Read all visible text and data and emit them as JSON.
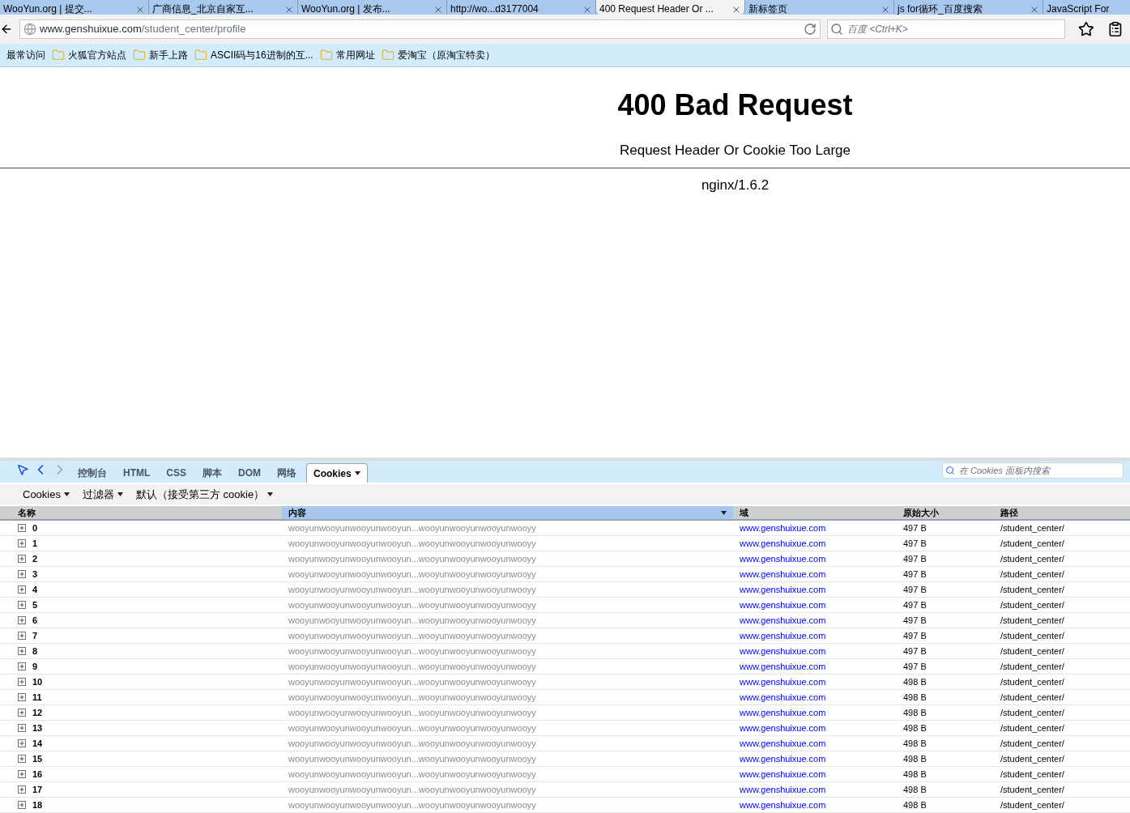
{
  "tabs": [
    {
      "label": "WooYun.org | 提交...",
      "selected": false
    },
    {
      "label": "广商信息_北京自家互...",
      "selected": false
    },
    {
      "label": "WooYun.org | 发布...",
      "selected": false
    },
    {
      "label": "http://wo...d3177004",
      "selected": false
    },
    {
      "label": "400 Request Header Or ...",
      "selected": true
    },
    {
      "label": "新标签页",
      "selected": false
    },
    {
      "label": "js for循环_百度搜索",
      "selected": false
    },
    {
      "label": "JavaScript For",
      "selected": false
    }
  ],
  "address": {
    "host": "www.genshuixue.com",
    "path": "/student_center/profile"
  },
  "search": {
    "placeholder": "百度 <Ctrl+K>"
  },
  "bookmarks": [
    "最常访问",
    "火狐官方站点",
    "新手上路",
    "ASCII码与16进制的互...",
    "常用网址",
    "爱淘宝（原淘宝特卖）"
  ],
  "page": {
    "title": "400 Bad Request",
    "message": "Request Header Or Cookie Too Large",
    "server": "nginx/1.6.2"
  },
  "devtools": {
    "tabs": [
      {
        "label": "控制台",
        "selected": false
      },
      {
        "label": "HTML",
        "selected": false
      },
      {
        "label": "CSS",
        "selected": false
      },
      {
        "label": "脚本",
        "selected": false
      },
      {
        "label": "DOM",
        "selected": false
      },
      {
        "label": "网络",
        "selected": false
      },
      {
        "label": "Cookies",
        "selected": true
      }
    ],
    "search": {
      "placeholder": "在 Cookies 面板内搜索"
    },
    "menus": [
      "Cookies",
      "过滤器",
      "默认（接受第三方 cookie）"
    ],
    "table": {
      "columns": [
        {
          "label": "名称",
          "selected": false
        },
        {
          "label": "内容",
          "selected": true
        },
        {
          "label": "域",
          "selected": false
        },
        {
          "label": "原始大小",
          "selected": false
        },
        {
          "label": "路径",
          "selected": false
        }
      ],
      "rows": [
        [
          "0",
          "wooyunwooyunwooyunwooyun...wooyunwooyunwooyunwooyy",
          "www.genshuixue.com",
          "497 B",
          "/student_center/"
        ],
        [
          "1",
          "wooyunwooyunwooyunwooyun...wooyunwooyunwooyunwooyy",
          "www.genshuixue.com",
          "497 B",
          "/student_center/"
        ],
        [
          "2",
          "wooyunwooyunwooyunwooyun...wooyunwooyunwooyunwooyy",
          "www.genshuixue.com",
          "497 B",
          "/student_center/"
        ],
        [
          "3",
          "wooyunwooyunwooyunwooyun...wooyunwooyunwooyunwooyy",
          "www.genshuixue.com",
          "497 B",
          "/student_center/"
        ],
        [
          "4",
          "wooyunwooyunwooyunwooyun...wooyunwooyunwooyunwooyy",
          "www.genshuixue.com",
          "497 B",
          "/student_center/"
        ],
        [
          "5",
          "wooyunwooyunwooyunwooyun...wooyunwooyunwooyunwooyy",
          "www.genshuixue.com",
          "497 B",
          "/student_center/"
        ],
        [
          "6",
          "wooyunwooyunwooyunwooyun...wooyunwooyunwooyunwooyy",
          "www.genshuixue.com",
          "497 B",
          "/student_center/"
        ],
        [
          "7",
          "wooyunwooyunwooyunwooyun...wooyunwooyunwooyunwooyy",
          "www.genshuixue.com",
          "497 B",
          "/student_center/"
        ],
        [
          "8",
          "wooyunwooyunwooyunwooyun...wooyunwooyunwooyunwooyy",
          "www.genshuixue.com",
          "497 B",
          "/student_center/"
        ],
        [
          "9",
          "wooyunwooyunwooyunwooyun...wooyunwooyunwooyunwooyy",
          "www.genshuixue.com",
          "497 B",
          "/student_center/"
        ],
        [
          "10",
          "wooyunwooyunwooyunwooyun...wooyunwooyunwooyunwooyy",
          "www.genshuixue.com",
          "498 B",
          "/student_center/"
        ],
        [
          "11",
          "wooyunwooyunwooyunwooyun...wooyunwooyunwooyunwooyy",
          "www.genshuixue.com",
          "498 B",
          "/student_center/"
        ],
        [
          "12",
          "wooyunwooyunwooyunwooyun...wooyunwooyunwooyunwooyy",
          "www.genshuixue.com",
          "498 B",
          "/student_center/"
        ],
        [
          "13",
          "wooyunwooyunwooyunwooyun...wooyunwooyunwooyunwooyy",
          "www.genshuixue.com",
          "498 B",
          "/student_center/"
        ],
        [
          "14",
          "wooyunwooyunwooyunwooyun...wooyunwooyunwooyunwooyy",
          "www.genshuixue.com",
          "498 B",
          "/student_center/"
        ],
        [
          "15",
          "wooyunwooyunwooyunwooyun...wooyunwooyunwooyunwooyy",
          "www.genshuixue.com",
          "498 B",
          "/student_center/"
        ],
        [
          "16",
          "wooyunwooyunwooyunwooyun...wooyunwooyunwooyunwooyy",
          "www.genshuixue.com",
          "498 B",
          "/student_center/"
        ],
        [
          "17",
          "wooyunwooyunwooyunwooyun...wooyunwooyunwooyunwooyy",
          "www.genshuixue.com",
          "498 B",
          "/student_center/"
        ],
        [
          "18",
          "wooyunwooyunwooyunwooyun...wooyunwooyunwooyunwooyy",
          "www.genshuixue.com",
          "498 B",
          "/student_center/"
        ]
      ]
    }
  }
}
